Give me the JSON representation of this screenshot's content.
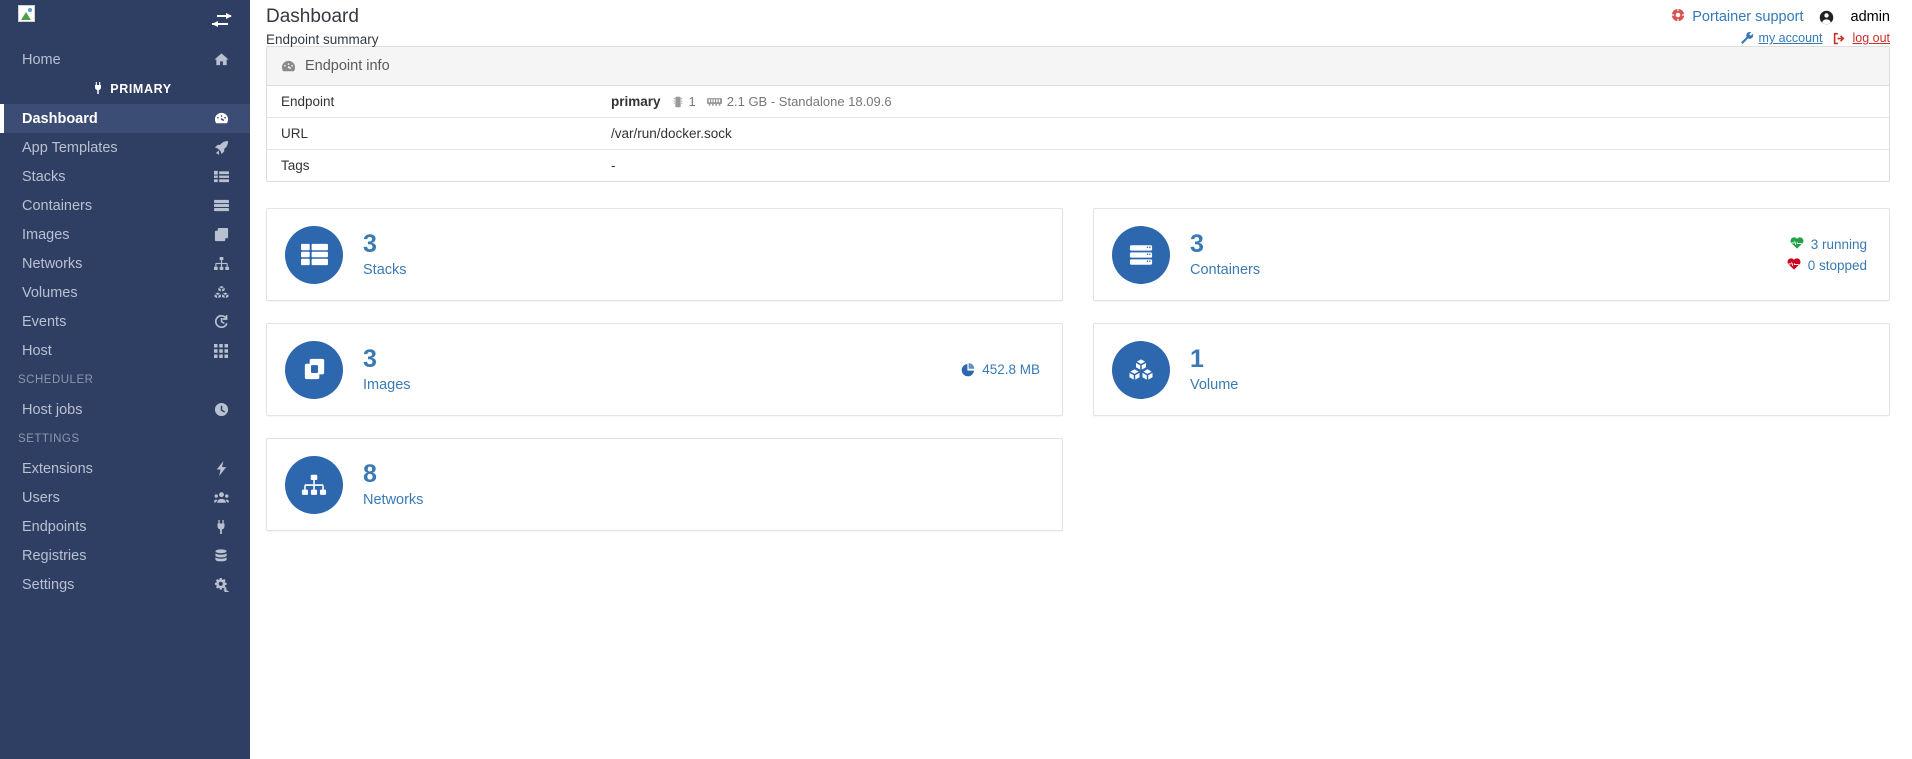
{
  "sidebar": {
    "logo_alt": "broken-image",
    "collapse_icon": "arrows-collapse-icon",
    "top_items": [
      {
        "label": "Home",
        "icon": "home-icon",
        "active": false
      }
    ],
    "endpoint_badge": {
      "label": "PRIMARY",
      "icon": "plug-icon"
    },
    "endpoint_items": [
      {
        "label": "Dashboard",
        "icon": "tachometer-icon",
        "active": true
      },
      {
        "label": "App Templates",
        "icon": "rocket-icon",
        "active": false
      },
      {
        "label": "Stacks",
        "icon": "list-icon",
        "active": false
      },
      {
        "label": "Containers",
        "icon": "server-icon",
        "active": false
      },
      {
        "label": "Images",
        "icon": "clone-icon",
        "active": false
      },
      {
        "label": "Networks",
        "icon": "sitemap-icon",
        "active": false
      },
      {
        "label": "Volumes",
        "icon": "cubes-icon",
        "active": false
      },
      {
        "label": "Events",
        "icon": "history-icon",
        "active": false
      },
      {
        "label": "Host",
        "icon": "th-icon",
        "active": false
      }
    ],
    "scheduler_section": "SCHEDULER",
    "scheduler_items": [
      {
        "label": "Host jobs",
        "icon": "clock-icon",
        "active": false
      }
    ],
    "settings_section": "SETTINGS",
    "settings_items": [
      {
        "label": "Extensions",
        "icon": "bolt-icon",
        "active": false
      },
      {
        "label": "Users",
        "icon": "users-icon",
        "active": false
      },
      {
        "label": "Endpoints",
        "icon": "plug-icon",
        "active": false
      },
      {
        "label": "Registries",
        "icon": "database-icon",
        "active": false
      },
      {
        "label": "Settings",
        "icon": "cogs-icon",
        "active": false
      }
    ]
  },
  "header": {
    "title": "Dashboard",
    "subtitle": "Endpoint summary",
    "support_label": "Portainer support",
    "support_icon": "life-ring-icon",
    "user_icon": "user-circle-icon",
    "username": "admin",
    "my_account_label": "my account",
    "my_account_icon": "wrench-icon",
    "logout_label": "log out",
    "logout_icon": "sign-out-icon"
  },
  "endpoint_info": {
    "panel_title": "Endpoint info",
    "panel_icon": "tachometer-icon",
    "rows": [
      {
        "key": "Endpoint",
        "value": "primary"
      },
      {
        "key": "URL",
        "value": "/var/run/docker.sock"
      },
      {
        "key": "Tags",
        "value": "-"
      }
    ],
    "cpu_icon": "microchip-icon",
    "cpu_count": "1",
    "memory_icon": "memory-icon",
    "memory_and_version": "2.1 GB - Standalone 18.09.6"
  },
  "cards": [
    {
      "count": "3",
      "label": "Stacks",
      "icon": "th-list-icon",
      "accent": "#2d68ae",
      "right": []
    },
    {
      "count": "3",
      "label": "Containers",
      "icon": "server-icon",
      "accent": "#2d68ae",
      "right": [
        {
          "icon": "heartbeat-green-icon",
          "text": "3 running",
          "color": "#24a148"
        },
        {
          "icon": "heartbeat-red-icon",
          "text": "0 stopped",
          "color": "#d0021b"
        }
      ]
    },
    {
      "count": "3",
      "label": "Images",
      "icon": "clone-icon",
      "accent": "#2d68ae",
      "right": [
        {
          "icon": "pie-chart-icon",
          "text": "452.8 MB",
          "color": "#3a7ab3"
        }
      ]
    },
    {
      "count": "1",
      "label": "Volume",
      "icon": "cubes-icon",
      "accent": "#2d68ae",
      "right": []
    },
    {
      "count": "8",
      "label": "Networks",
      "icon": "sitemap-icon",
      "accent": "#2d68ae",
      "right": []
    }
  ]
}
